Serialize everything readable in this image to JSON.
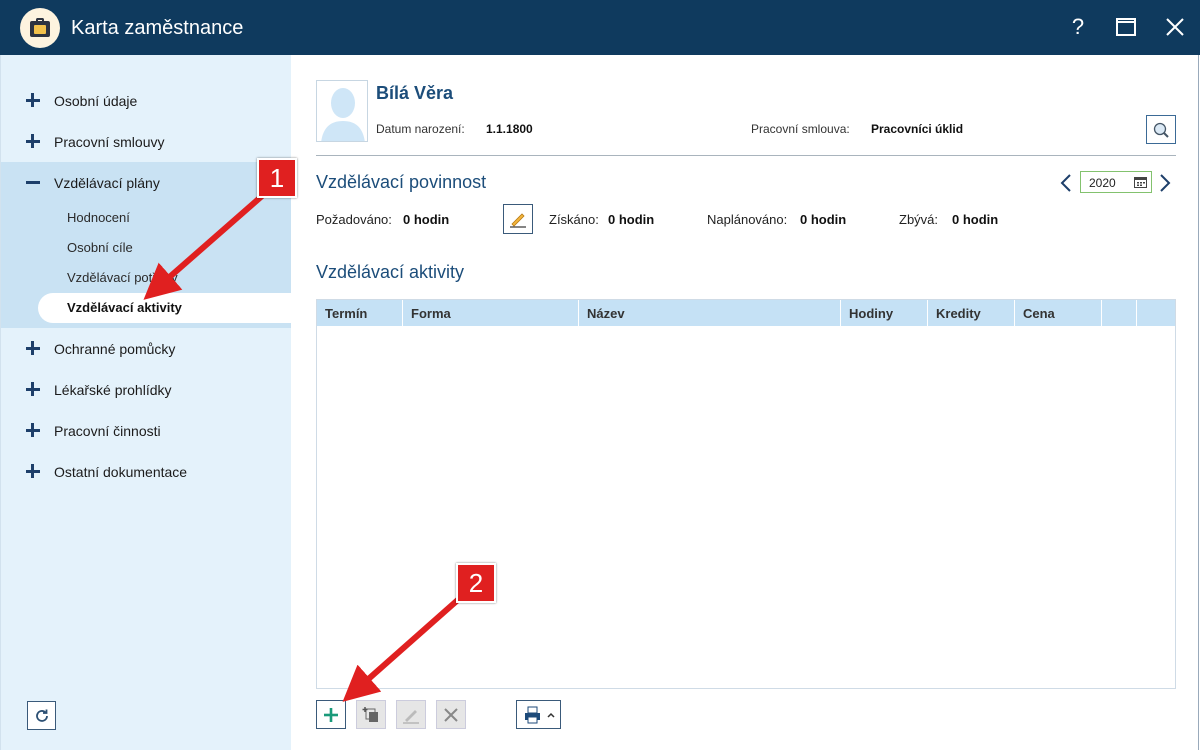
{
  "window": {
    "title": "Karta zaměstnance",
    "help_label": "?",
    "maximize_label": "☐",
    "close_label": "✕"
  },
  "sidebar": {
    "items": [
      {
        "label": "Osobní údaje"
      },
      {
        "label": "Pracovní smlouvy"
      },
      {
        "label": "Vzdělávací plány"
      },
      {
        "label": "Ochranné pomůcky"
      },
      {
        "label": "Lékařské prohlídky"
      },
      {
        "label": "Pracovní činnosti"
      },
      {
        "label": "Ostatní dokumentace"
      }
    ],
    "subitems": [
      {
        "label": "Hodnocení"
      },
      {
        "label": "Osobní cíle"
      },
      {
        "label": "Vzdělávací potřeby"
      },
      {
        "label": "Vzdělávací aktivity"
      }
    ]
  },
  "employee": {
    "name": "Bílá Věra",
    "birth_label": "Datum narození:",
    "birth_value": "1.1.1800",
    "contract_label": "Pracovní smlouva:",
    "contract_value": "Pracovníci úklid"
  },
  "obligation": {
    "title": "Vzdělávací povinnost",
    "year": "2020",
    "required_label": "Požadováno:",
    "required_value": "0 hodin",
    "obtained_label": "Získáno:",
    "obtained_value": "0 hodin",
    "planned_label": "Naplánováno:",
    "planned_value": "0 hodin",
    "remaining_label": "Zbývá:",
    "remaining_value": "0 hodin"
  },
  "activities": {
    "title": "Vzdělávací aktivity",
    "columns": [
      "Termín",
      "Forma",
      "Název",
      "Hodiny",
      "Kredity",
      "Cena"
    ]
  },
  "annotations": {
    "step1": "1",
    "step2": "2",
    "color": "#e02020"
  },
  "icons": {
    "app": "employee-card-icon",
    "refresh": "refresh-icon",
    "search": "search-icon",
    "prev": "chevron-left-icon",
    "next": "chevron-right-icon",
    "calendar": "calendar-icon",
    "edit": "pencil-icon",
    "add": "plus-icon",
    "copy": "copy-icon",
    "delete": "x-icon",
    "print": "printer-icon"
  }
}
